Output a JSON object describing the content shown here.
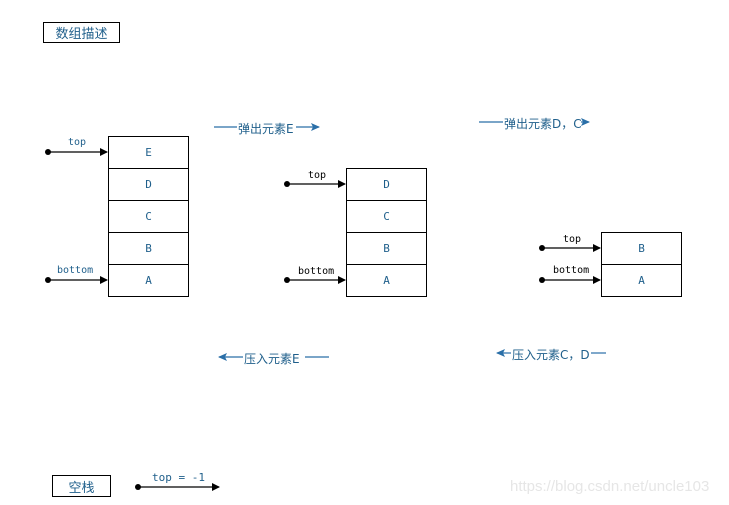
{
  "title": "数组描述",
  "stacks": [
    {
      "name": "initial",
      "cells_top_to_bottom": [
        "E",
        "D",
        "C",
        "B",
        "A"
      ],
      "pointers": {
        "top": "top",
        "bottom": "bottom"
      }
    },
    {
      "name": "after-pop-e",
      "cells_top_to_bottom": [
        "D",
        "C",
        "B",
        "A"
      ],
      "pointers": {
        "top": "top",
        "bottom": "bottom"
      }
    },
    {
      "name": "after-pop-dc",
      "cells_top_to_bottom": [
        "B",
        "A"
      ],
      "pointers": {
        "top": "top",
        "bottom": "bottom"
      }
    }
  ],
  "operations": {
    "pop_e": "弹出元素E",
    "pop_dc": "弹出元素D，C",
    "push_e": "压入元素E",
    "push_cd": "压入元素C，D"
  },
  "empty_stack": {
    "label": "空栈",
    "pointer_text": "top = -1"
  },
  "watermark": "https://blog.csdn.net/uncle103",
  "colors": {
    "text_blue": "#1f5f8b",
    "arrow_blue": "#2a6fa8",
    "line": "#000000"
  }
}
